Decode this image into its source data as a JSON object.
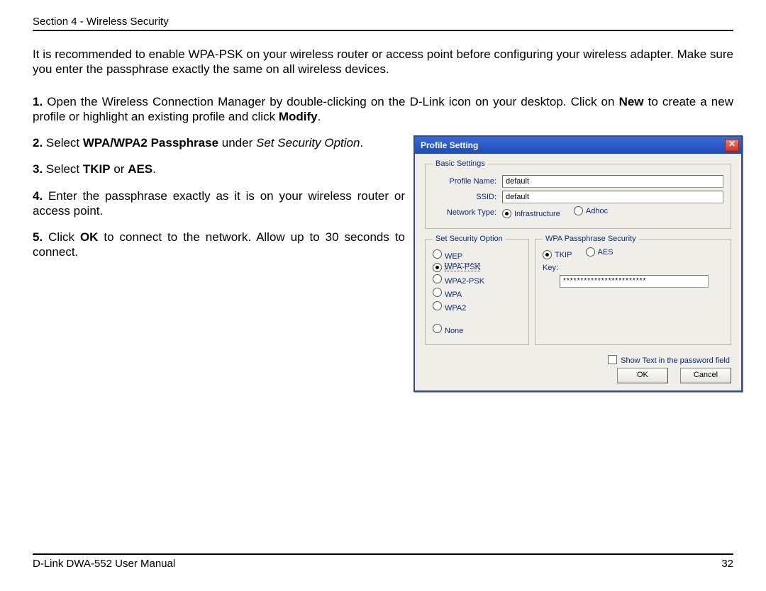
{
  "header": {
    "section": "Section 4 - Wireless Security"
  },
  "intro": "It is recommended to enable WPA-PSK on your wireless router or access point before configuring your wireless adapter. Make sure you enter the passphrase exactly the same on all wireless devices.",
  "steps": {
    "s1": {
      "num": "1.",
      "a": " Open the Wireless Connection Manager by double-clicking on the D-Link icon on your desktop. Click on ",
      "b": "New",
      "c": " to create a new profile or highlight an existing profile and click ",
      "d": "Modify",
      "e": "."
    },
    "s2": {
      "num": "2.",
      "a": " Select ",
      "b": "WPA/WPA2 Passphrase",
      "c": " under ",
      "d": "Set Security Option",
      "e": "."
    },
    "s3": {
      "num": "3.",
      "a": " Select ",
      "b": "TKIP",
      "c": " or ",
      "d": "AES",
      "e": "."
    },
    "s4": {
      "num": "4.",
      "a": " Enter the passphrase exactly as it is on your wireless router or access point."
    },
    "s5": {
      "num": "5.",
      "a": " Click ",
      "b": "OK",
      "c": " to connect to the network. Allow up to 30 seconds to connect."
    }
  },
  "dialog": {
    "title": "Profile Setting",
    "close_glyph": "✕",
    "basic": {
      "legend": "Basic Settings",
      "profile_label": "Profile Name:",
      "profile_value": "default",
      "ssid_label": "SSID:",
      "ssid_value": "default",
      "ntype_label": "Network Type:",
      "ntype_options": {
        "infra": "Infrastructure",
        "adhoc": "Adhoc"
      },
      "ntype_selected": "infra"
    },
    "security": {
      "legend": "Set Security Option",
      "options": {
        "wep": "WEP",
        "wpa_psk": "WPA-PSK",
        "wpa2_psk": "WPA2-PSK",
        "wpa": "WPA",
        "wpa2": "WPA2",
        "none": "None"
      },
      "selected": "wpa_psk"
    },
    "wpa": {
      "legend": "WPA Passphrase Security",
      "cipher_options": {
        "tkip": "TKIP",
        "aes": "AES"
      },
      "cipher_selected": "tkip",
      "key_label": "Key:",
      "key_value": "************************"
    },
    "show_pw": "Show Text in the password field",
    "ok": "OK",
    "cancel": "Cancel"
  },
  "footer": {
    "left": "D-Link DWA-552 User Manual",
    "right": "32"
  }
}
